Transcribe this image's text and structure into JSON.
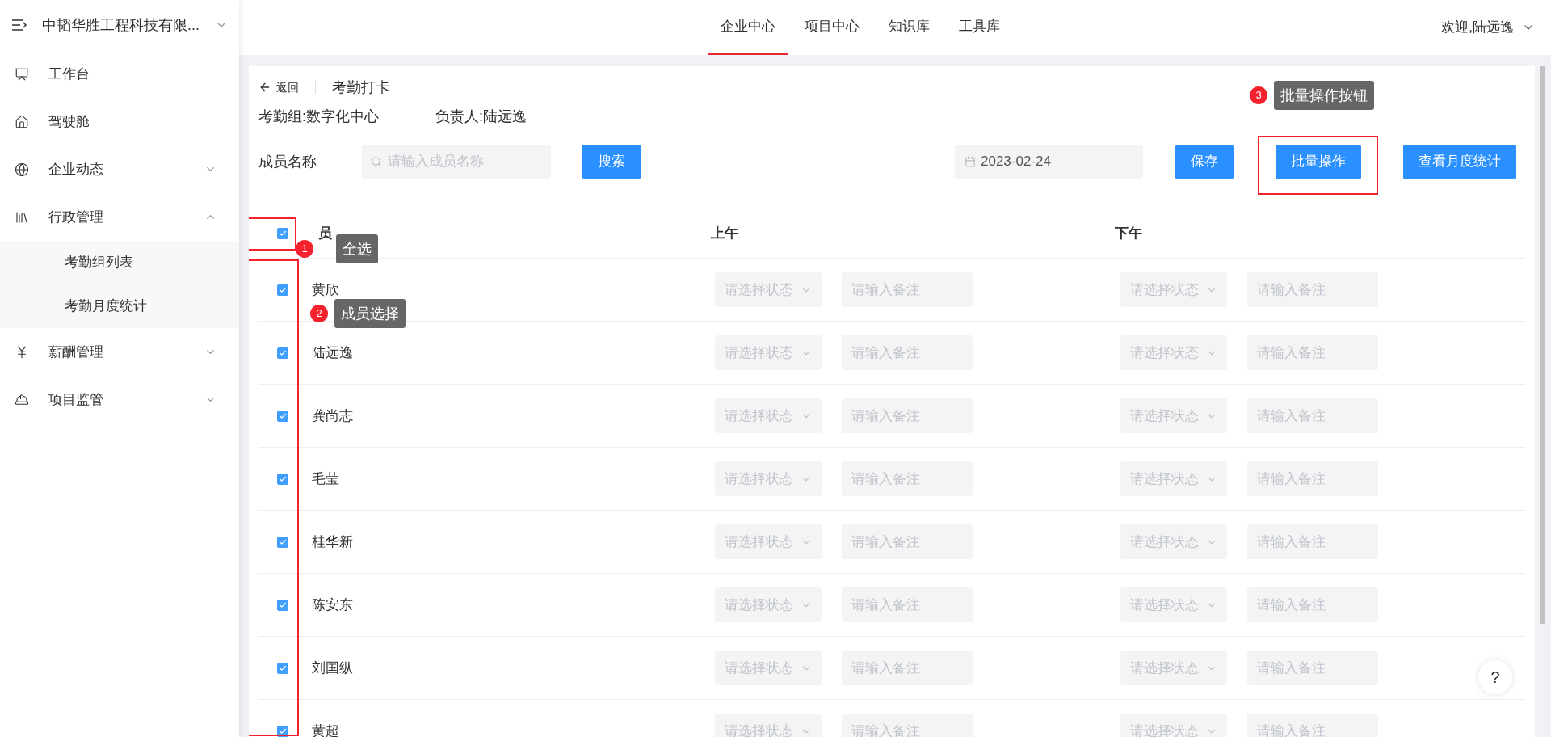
{
  "sidebar": {
    "company": "中韬华胜工程科技有限...",
    "items": [
      {
        "label": "工作台",
        "kind": "link"
      },
      {
        "label": "驾驶舱",
        "kind": "link"
      },
      {
        "label": "企业动态",
        "kind": "group",
        "expanded": false
      },
      {
        "label": "行政管理",
        "kind": "group",
        "expanded": true,
        "children": [
          {
            "label": "考勤组列表"
          },
          {
            "label": "考勤月度统计"
          }
        ]
      },
      {
        "label": "薪酬管理",
        "kind": "group",
        "expanded": false
      },
      {
        "label": "项目监管",
        "kind": "group",
        "expanded": false
      }
    ]
  },
  "nav": {
    "tabs": [
      {
        "label": "企业中心",
        "selected": true
      },
      {
        "label": "项目中心",
        "selected": false
      },
      {
        "label": "知识库",
        "selected": false
      },
      {
        "label": "工具库",
        "selected": false
      }
    ],
    "user": "欢迎,陆远逸"
  },
  "page": {
    "back": "返回",
    "title": "考勤打卡",
    "info": [
      "考勤组:数字化中心",
      "负责人:陆远逸"
    ],
    "filter": {
      "label": "成员名称",
      "placeholder": "请输入成员名称",
      "search_button": "搜索",
      "date": "2023-02-24",
      "buttons": [
        "保存",
        "批量操作",
        "查看月度统计"
      ]
    }
  },
  "table": {
    "select_all": true,
    "column_1": "员",
    "morning": "上午",
    "afternoon": "下午",
    "rows": [
      {
        "name": "黄欣",
        "checked": true,
        "am_status": "请选择状态",
        "am_note": "请输入备注",
        "pm_status": "请选择状态",
        "pm_note": "请输入备注"
      },
      {
        "name": "陆远逸",
        "checked": true,
        "am_status": "请选择状态",
        "am_note": "请输入备注",
        "pm_status": "请选择状态",
        "pm_note": "请输入备注"
      },
      {
        "name": "龚尚志",
        "checked": true,
        "am_status": "请选择状态",
        "am_note": "请输入备注",
        "pm_status": "请选择状态",
        "pm_note": "请输入备注"
      },
      {
        "name": "毛莹",
        "checked": true,
        "am_status": "请选择状态",
        "am_note": "请输入备注",
        "pm_status": "请选择状态",
        "pm_note": "请输入备注"
      },
      {
        "name": "桂华新",
        "checked": true,
        "am_status": "请选择状态",
        "am_note": "请输入备注",
        "pm_status": "请选择状态",
        "pm_note": "请输入备注"
      },
      {
        "name": "陈安东",
        "checked": true,
        "am_status": "请选择状态",
        "am_note": "请输入备注",
        "pm_status": "请选择状态",
        "pm_note": "请输入备注"
      },
      {
        "name": "刘国纵",
        "checked": true,
        "am_status": "请选择状态",
        "am_note": "请输入备注",
        "pm_status": "请选择状态",
        "pm_note": "请输入备注"
      },
      {
        "name": "黄超",
        "checked": true,
        "am_status": "请选择状态",
        "am_note": "请输入备注",
        "pm_status": "请选择状态",
        "pm_note": "请输入备注"
      }
    ]
  },
  "annotations": [
    {
      "number": "1",
      "text": "全选"
    },
    {
      "number": "2",
      "text": "成员选择"
    },
    {
      "number": "3",
      "text": "批量操作按钮"
    }
  ],
  "help": "?"
}
